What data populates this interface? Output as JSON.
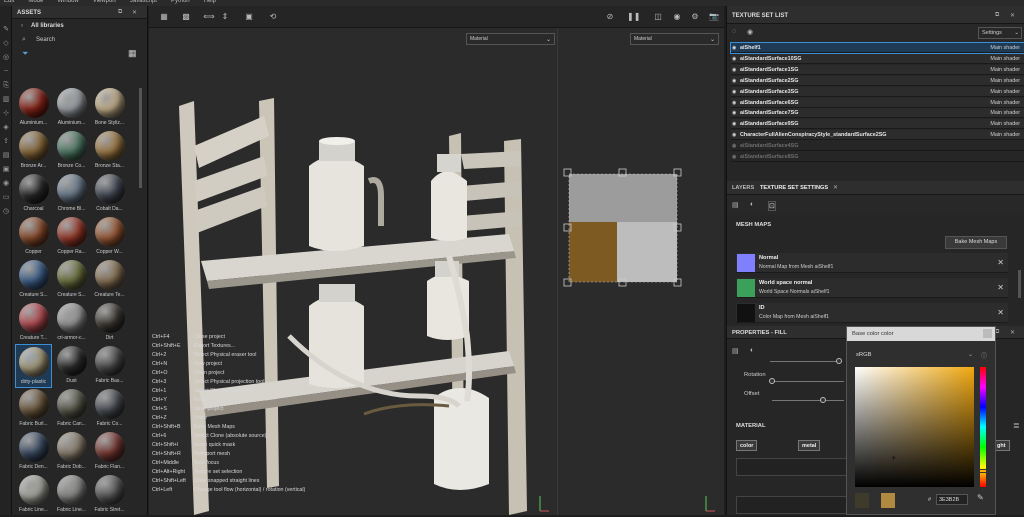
{
  "menu": [
    "Edit",
    "Mode",
    "Window",
    "Viewport",
    "Javascript",
    "Python",
    "Help"
  ],
  "assets": {
    "title": "ASSETS",
    "all_libraries": "All libraries",
    "search_label": "Search",
    "materials": [
      {
        "label": "Aluminium...",
        "color": "#8a2418"
      },
      {
        "label": "Aluminium...",
        "color": "#9ea3a8"
      },
      {
        "label": "Bone Styliz...",
        "color": "#c7b28c"
      },
      {
        "label": "Bronze Ar...",
        "color": "#8a6a3a"
      },
      {
        "label": "Bronze Co...",
        "color": "#4f7a66"
      },
      {
        "label": "Bronze Sta...",
        "color": "#a07b46"
      },
      {
        "label": "Charcoal",
        "color": "#2b2b2b"
      },
      {
        "label": "Chrome Bl...",
        "color": "#6b7b8c"
      },
      {
        "label": "Cobalt Da...",
        "color": "#444a55"
      },
      {
        "label": "Copper",
        "color": "#8a4a2a"
      },
      {
        "label": "Copper Ra...",
        "color": "#9a3a2a"
      },
      {
        "label": "Copper W...",
        "color": "#9c5a36"
      },
      {
        "label": "Creature S...",
        "color": "#3d5f8a"
      },
      {
        "label": "Creature S...",
        "color": "#6e7440"
      },
      {
        "label": "Creature Te...",
        "color": "#8a7356"
      },
      {
        "label": "Creature T...",
        "color": "#b84e54"
      },
      {
        "label": "cri-armor-c...",
        "color": "#9a9a9a"
      },
      {
        "label": "Dirt",
        "color": "#3e3a34"
      },
      {
        "label": "dirty-plastic",
        "color": "#a69a7a"
      },
      {
        "label": "Dust",
        "color": "#2f2f2f"
      },
      {
        "label": "Fabric Bas...",
        "color": "#4c4c4c"
      },
      {
        "label": "Fabric Burl...",
        "color": "#6e5a3e"
      },
      {
        "label": "Fabric Can...",
        "color": "#5a5a4c"
      },
      {
        "label": "Fabric Co...",
        "color": "#4a4e55"
      },
      {
        "label": "Fabric Den...",
        "color": "#3b4c64"
      },
      {
        "label": "Fabric Dob...",
        "color": "#8c8070"
      },
      {
        "label": "Fabric Flan...",
        "color": "#7a3a34"
      },
      {
        "label": "Fabric Line...",
        "color": "#a8a8a0"
      },
      {
        "label": "Fabric Line...",
        "color": "#8a8a88"
      },
      {
        "label": "Fabric Stret...",
        "color": "#5a5a5a"
      }
    ]
  },
  "viewport": {
    "dropdown_left": "Material",
    "dropdown_right": "Material",
    "shortcuts": [
      {
        "key": "Ctrl+F4",
        "action": "Close project"
      },
      {
        "key": "Ctrl+Shift+E",
        "action": "Export Textures..."
      },
      {
        "key": "Ctrl+2",
        "action": "Select Physical eraser tool"
      },
      {
        "key": "Ctrl+N",
        "action": "New project"
      },
      {
        "key": "Ctrl+O",
        "action": "Open project"
      },
      {
        "key": "Ctrl+3",
        "action": "Select Physical projection tool"
      },
      {
        "key": "Ctrl+1",
        "action": "Select Physical paint tool"
      },
      {
        "key": "Ctrl+Y",
        "action": "Redo"
      },
      {
        "key": "Ctrl+S",
        "action": "Save project"
      },
      {
        "key": "Ctrl+Z",
        "action": "Undo"
      },
      {
        "key": "Ctrl+Shift+B",
        "action": "Bake Mesh Maps"
      },
      {
        "key": "Ctrl+6",
        "action": "Select Clone (absolute source)"
      },
      {
        "key": "Ctrl+Shift+I",
        "action": "Invert quick mask"
      },
      {
        "key": "Ctrl+Shift+R",
        "action": "Reimport mesh"
      },
      {
        "key": "",
        "action": ""
      },
      {
        "key": "Ctrl+Middle",
        "action": "Auto focus"
      },
      {
        "key": "Ctrl+Alt+Right",
        "action": "Texture set selection"
      },
      {
        "key": "Ctrl+Shift+Left",
        "action": "Draw snapped straight lines"
      },
      {
        "key": "Ctrl+Left",
        "action": "Change tool flow (horizontal) / rotation (vertical)"
      }
    ]
  },
  "texture_set_list": {
    "title": "TEXTURE SET LIST",
    "settings_label": "Settings",
    "items": [
      {
        "name": "aiShelf1",
        "shader": "Main shader",
        "enabled": true
      },
      {
        "name": "aiStandardSurface10SG",
        "shader": "Main shader",
        "enabled": true
      },
      {
        "name": "aiStandardSurface1SG",
        "shader": "Main shader",
        "enabled": true
      },
      {
        "name": "aiStandardSurface2SG",
        "shader": "Main shader",
        "enabled": true
      },
      {
        "name": "aiStandardSurface3SG",
        "shader": "Main shader",
        "enabled": true
      },
      {
        "name": "aiStandardSurface6SG",
        "shader": "Main shader",
        "enabled": true
      },
      {
        "name": "aiStandardSurface7SG",
        "shader": "Main shader",
        "enabled": true
      },
      {
        "name": "aiStandardSurface9SG",
        "shader": "Main shader",
        "enabled": true
      },
      {
        "name": "CharacterFullAlienConspiracyStyle_standardSurface2SG",
        "shader": "Main shader",
        "enabled": true
      },
      {
        "name": "aiStandardSurface4SG",
        "shader": "",
        "enabled": false
      },
      {
        "name": "aiStandardSurface8SG",
        "shader": "",
        "enabled": false
      }
    ]
  },
  "tabs": {
    "layers": "LAYERS",
    "texture_set_settings": "TEXTURE SET SETTINGS"
  },
  "mesh_maps": {
    "title": "MESH MAPS",
    "bake_button": "Bake Mesh Maps",
    "items": [
      {
        "title": "Normal",
        "desc": "Normal Map from Mesh aiShelf1",
        "color": "#8080ff"
      },
      {
        "title": "World space normal",
        "desc": "World Space Normals aiShelf1",
        "color": "#3aa05a"
      },
      {
        "title": "ID",
        "desc": "Color Map from Mesh aiShelf1",
        "color": "#111111"
      }
    ]
  },
  "properties": {
    "title": "PROPERTIES - FILL",
    "rotation_label": "Rotation",
    "offset_label": "Offset",
    "material_label": "MATERIAL",
    "chips": [
      "color",
      "metal",
      "ght"
    ]
  },
  "color_picker": {
    "title": "Base color color",
    "mode": "sRGB",
    "hex_label": "#",
    "hex_value": "3E3B2B",
    "swatch_old": "#3e3b2b",
    "swatch_new": "#b08a40"
  },
  "colors": {
    "accent": "#3a8fd6",
    "selection": "#1f3a55"
  }
}
